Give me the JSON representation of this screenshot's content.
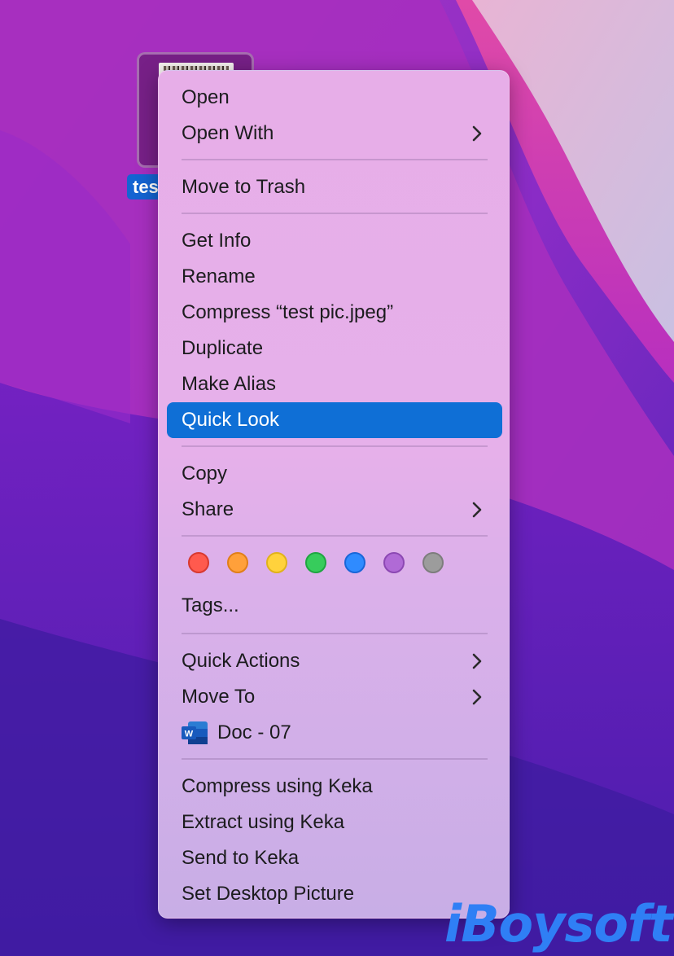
{
  "desktop": {
    "file_label": "tes",
    "watermark": "iBoysoft"
  },
  "menu": {
    "items": {
      "open": "Open",
      "open_with": "Open With",
      "move_to_trash": "Move to Trash",
      "get_info": "Get Info",
      "rename": "Rename",
      "compress": "Compress “test pic.jpeg”",
      "duplicate": "Duplicate",
      "make_alias": "Make Alias",
      "quick_look": "Quick Look",
      "copy": "Copy",
      "share": "Share",
      "tags": "Tags...",
      "quick_actions": "Quick Actions",
      "move_to": "Move To",
      "doc": "Doc - 07",
      "compress_keka": "Compress using Keka",
      "extract_keka": "Extract using Keka",
      "send_keka": "Send to Keka",
      "set_desktop_picture": "Set Desktop Picture"
    },
    "highlighted": "quick_look",
    "tag_colors": [
      {
        "name": "red",
        "fill": "#ff5a4e",
        "stroke": "#d8392f"
      },
      {
        "name": "orange",
        "fill": "#ffa03a",
        "stroke": "#e07f18"
      },
      {
        "name": "yellow",
        "fill": "#ffd23c",
        "stroke": "#e0b21a"
      },
      {
        "name": "green",
        "fill": "#37cc5c",
        "stroke": "#1fa542"
      },
      {
        "name": "blue",
        "fill": "#2f8bff",
        "stroke": "#1966d8"
      },
      {
        "name": "purple",
        "fill": "#b06ad6",
        "stroke": "#8c48b3"
      },
      {
        "name": "gray",
        "fill": "#9c9c9c",
        "stroke": "#7d7d7d"
      }
    ],
    "icons": {
      "submenu": "chevron-right-icon",
      "doc": "microsoft-word-icon"
    }
  }
}
